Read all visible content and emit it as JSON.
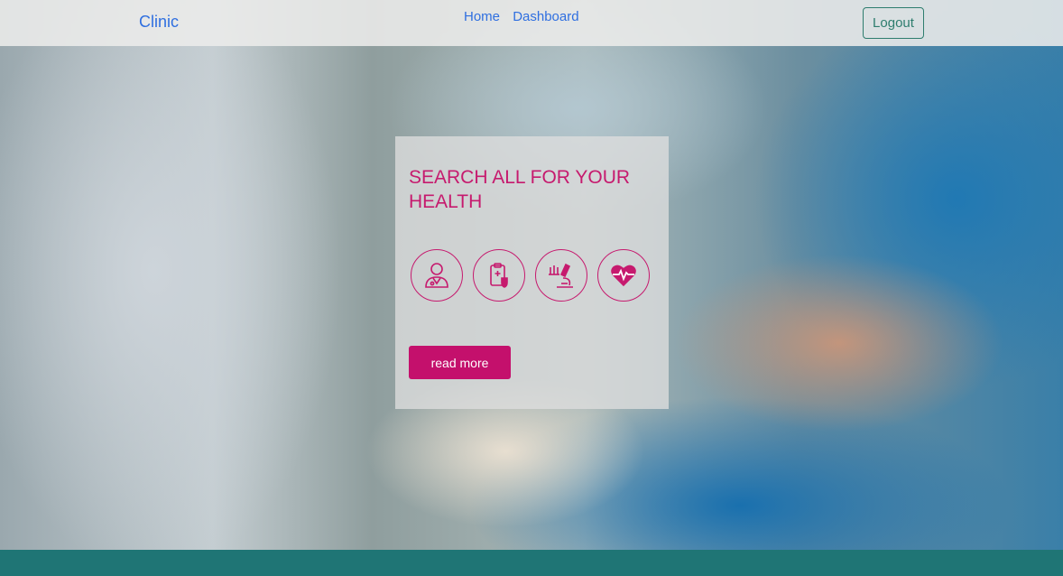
{
  "navbar": {
    "brand": "Clinic",
    "links": [
      {
        "label": "Home"
      },
      {
        "label": "Dashboard"
      }
    ],
    "logout_label": "Logout"
  },
  "hero": {
    "title": "SEARCH ALL FOR YOUR HEALTH",
    "icons": [
      "doctor-icon",
      "clipboard-shield-icon",
      "microscope-icon",
      "heart-pulse-icon"
    ],
    "button_label": "read more"
  },
  "colors": {
    "accent": "#c4106c",
    "link": "#2f6fe0",
    "teal": "#1f7575"
  }
}
